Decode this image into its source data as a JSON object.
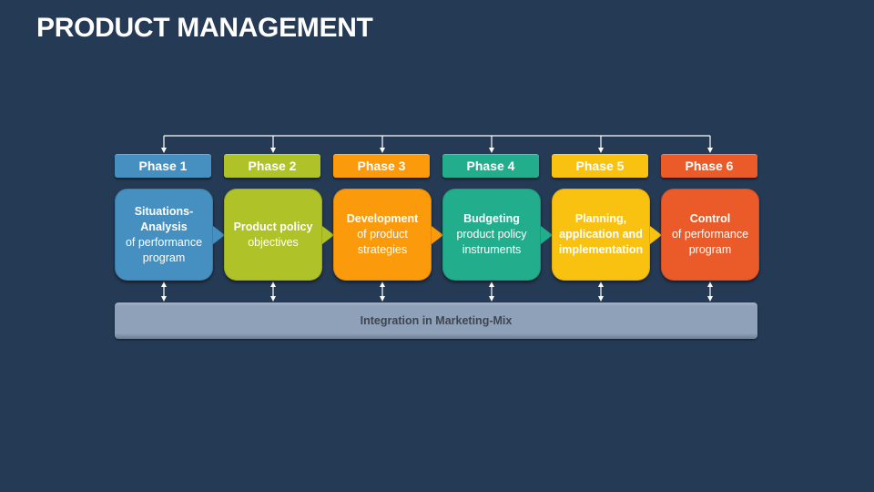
{
  "title": "PRODUCT MANAGEMENT",
  "phases": [
    {
      "tab": "Phase 1",
      "color": "#4590C0",
      "lines": [
        {
          "text": "Situations-",
          "bold": true
        },
        {
          "text": "Analysis",
          "bold": true
        },
        {
          "text": "of performance",
          "bold": false
        },
        {
          "text": "program",
          "bold": false
        }
      ]
    },
    {
      "tab": "Phase 2",
      "color": "#AFC228",
      "lines": [
        {
          "text": "Product policy",
          "bold": true
        },
        {
          "text": "objectives",
          "bold": false
        }
      ]
    },
    {
      "tab": "Phase 3",
      "color": "#FB9A0A",
      "lines": [
        {
          "text": "Development",
          "bold": true
        },
        {
          "text": "of product",
          "bold": false
        },
        {
          "text": "strategies",
          "bold": false
        }
      ]
    },
    {
      "tab": "Phase 4",
      "color": "#22AE8C",
      "lines": [
        {
          "text": "Budgeting",
          "bold": true
        },
        {
          "text": "product policy",
          "bold": false
        },
        {
          "text": "instruments",
          "bold": false
        }
      ]
    },
    {
      "tab": "Phase 5",
      "color": "#FAC210",
      "lines": [
        {
          "text": "Planning,",
          "bold": true
        },
        {
          "text": "application and",
          "bold": true
        },
        {
          "text": "implementation",
          "bold": true
        }
      ]
    },
    {
      "tab": "Phase 6",
      "color": "#EB5B2A",
      "lines": [
        {
          "text": "Control",
          "bold": true
        },
        {
          "text": "of performance",
          "bold": false
        },
        {
          "text": "program",
          "bold": false
        }
      ]
    }
  ],
  "integration": "Integration in Marketing-Mix"
}
